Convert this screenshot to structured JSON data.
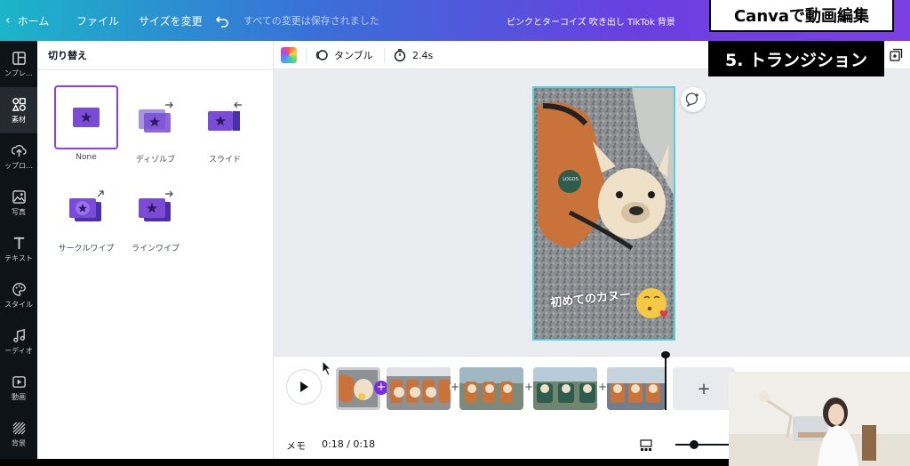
{
  "topbar": {
    "back_label": "ホーム",
    "file_label": "ファイル",
    "resize_label": "サイズを変更",
    "save_status": "すべての変更は保存されました",
    "doc_title": "ピンクとターコイズ 吹き出し TikTok 背景"
  },
  "rail": {
    "items": [
      {
        "label": "ンプレ…",
        "icon": "templates-icon"
      },
      {
        "label": "素材",
        "icon": "elements-icon"
      },
      {
        "label": "ップロ…",
        "icon": "upload-icon"
      },
      {
        "label": "写真",
        "icon": "photo-icon"
      },
      {
        "label": "テキスト",
        "icon": "text-icon"
      },
      {
        "label": "スタイル",
        "icon": "palette-icon"
      },
      {
        "label": "ーディオ",
        "icon": "music-icon"
      },
      {
        "label": "動画",
        "icon": "video-icon"
      },
      {
        "label": "背景",
        "icon": "background-icon"
      }
    ]
  },
  "panel": {
    "title": "切り替え",
    "transitions": [
      {
        "label": "None",
        "selected": true
      },
      {
        "label": "ディゾルブ",
        "selected": false
      },
      {
        "label": "スライド",
        "selected": false
      },
      {
        "label": "サークルワイプ",
        "selected": false
      },
      {
        "label": "ラインワイプ",
        "selected": false
      }
    ]
  },
  "toolbar": {
    "tumble_label": "タンブル",
    "duration_label": "2.4s"
  },
  "canvas": {
    "caption": "初めてのカヌー",
    "patch_text": "LOGOS"
  },
  "timeline": {
    "memo_label": "メモ",
    "time_label": "0:18 / 0:18",
    "add_page_label": "+"
  },
  "overlay": {
    "title": "Canvaで動画編集",
    "chapter": "5. トランジション"
  },
  "colors": {
    "brand_purple": "#8b3dff",
    "page_border": "#5ad0d9"
  }
}
